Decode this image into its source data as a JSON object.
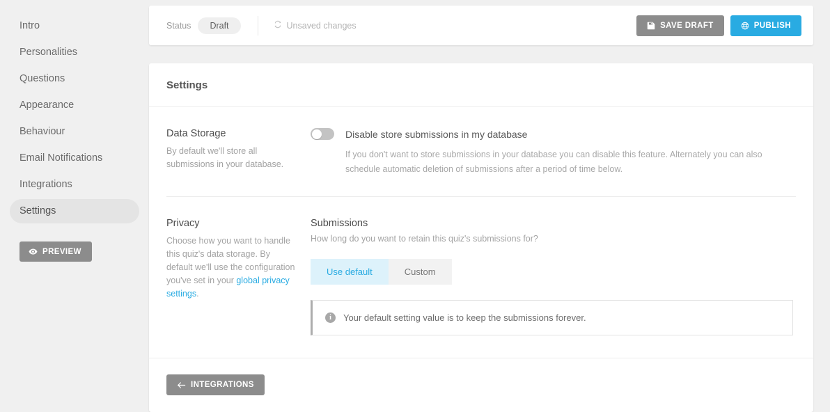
{
  "sidebar": {
    "items": [
      {
        "label": "Intro",
        "active": false
      },
      {
        "label": "Personalities",
        "active": false
      },
      {
        "label": "Questions",
        "active": false
      },
      {
        "label": "Appearance",
        "active": false
      },
      {
        "label": "Behaviour",
        "active": false
      },
      {
        "label": "Email Notifications",
        "active": false
      },
      {
        "label": "Integrations",
        "active": false
      },
      {
        "label": "Settings",
        "active": true
      }
    ],
    "preview_button": {
      "label": "PREVIEW",
      "icon": "eye-icon"
    }
  },
  "topbar": {
    "status_label": "Status",
    "status_value": "Draft",
    "unsaved_text": "Unsaved changes",
    "unsaved_icon": "sync-icon",
    "save_draft": {
      "label": "SAVE DRAFT",
      "icon": "save-icon"
    },
    "publish": {
      "label": "PUBLISH",
      "icon": "globe-icon"
    }
  },
  "settings": {
    "card_title": "Settings",
    "data_storage": {
      "title": "Data Storage",
      "description": "By default we'll store all submissions in your database.",
      "toggle_label": "Disable store submissions in my database",
      "toggle_state": "off",
      "help_text": "If you don't want to store submissions in your database you can disable this feature. Alternately you can also schedule automatic deletion of submissions after a period of time below."
    },
    "privacy": {
      "title": "Privacy",
      "description_before_link": "Choose how you want to handle this quiz's data storage. By default we'll use the configuration you've set in your ",
      "link_text": "global privacy settings",
      "description_after_link": ".",
      "submissions_title": "Submissions",
      "submissions_question": "How long do you want to retain this quiz's submissions for?",
      "options": [
        {
          "label": "Use default",
          "selected": true
        },
        {
          "label": "Custom",
          "selected": false
        }
      ],
      "alert_text": "Your default setting value is to keep the submissions forever.",
      "alert_icon": "info-icon"
    },
    "footer": {
      "back_button": {
        "label": "INTEGRATIONS",
        "icon": "arrow-left-icon"
      }
    }
  },
  "colors": {
    "accent_blue": "#29abe2",
    "gray_button": "#8c8c8c",
    "segment_active_bg": "#ddf2fb",
    "page_bg": "#f0f0f0"
  }
}
